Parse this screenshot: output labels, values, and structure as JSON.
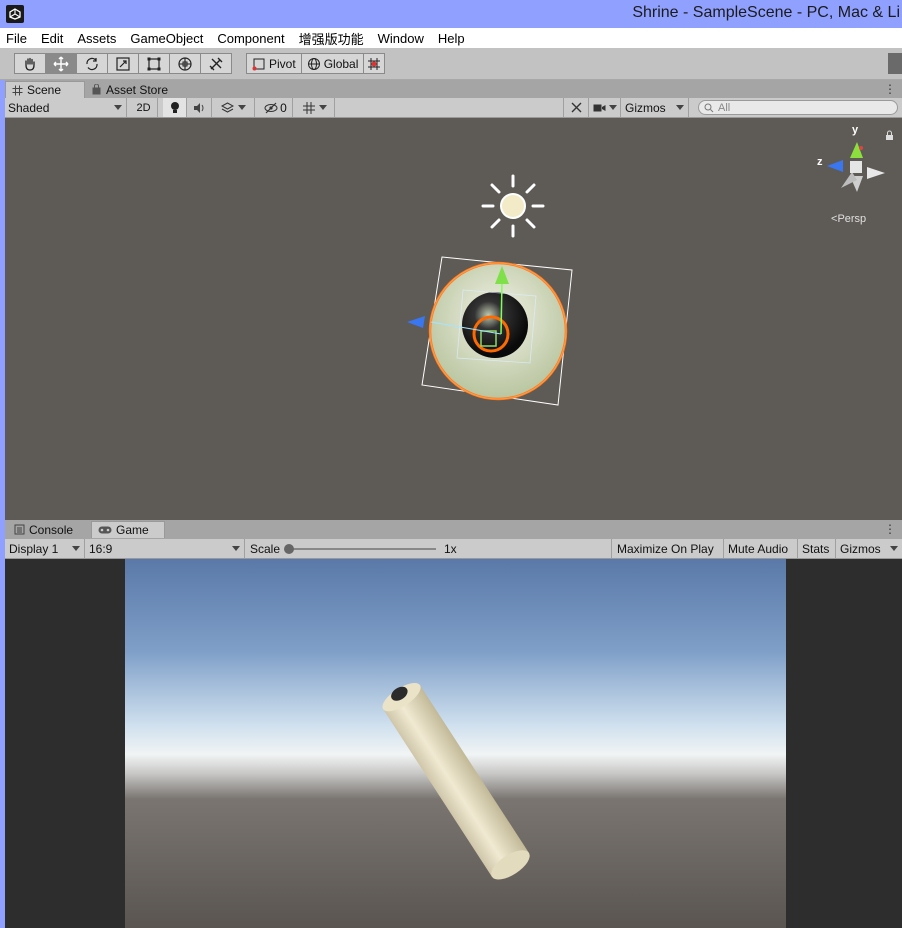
{
  "window": {
    "title": "Shrine - SampleScene - PC, Mac & Li",
    "app_icon": "unity-logo-icon"
  },
  "menu": [
    "File",
    "Edit",
    "Assets",
    "GameObject",
    "Component",
    "增强版功能",
    "Window",
    "Help"
  ],
  "toolbar": {
    "tools": [
      "hand-tool-icon",
      "move-tool-icon",
      "rotate-tool-icon",
      "scale-tool-icon",
      "rect-tool-icon",
      "transform-tool-icon",
      "custom-tool-icon"
    ],
    "active_tool": "move-tool-icon",
    "pivot_label": "Pivot",
    "global_label": "Global"
  },
  "top_tabs": {
    "scene": "Scene",
    "asset_store": "Asset Store"
  },
  "scene_toolbar": {
    "shading_mode": "Shaded",
    "mode_2d": "2D",
    "hidden_count": "0",
    "gizmos": "Gizmos",
    "search_placeholder": "All"
  },
  "scene_view": {
    "projection_label": "Persp",
    "axis_y": "y",
    "axis_z": "z"
  },
  "bottom_tabs": {
    "console": "Console",
    "game": "Game"
  },
  "game_toolbar": {
    "display": "Display 1",
    "aspect": "16:9",
    "scale_label": "Scale",
    "scale_value": "1x",
    "maximize_on_play": "Maximize On Play",
    "mute_audio": "Mute Audio",
    "stats": "Stats",
    "gizmos": "Gizmos"
  }
}
